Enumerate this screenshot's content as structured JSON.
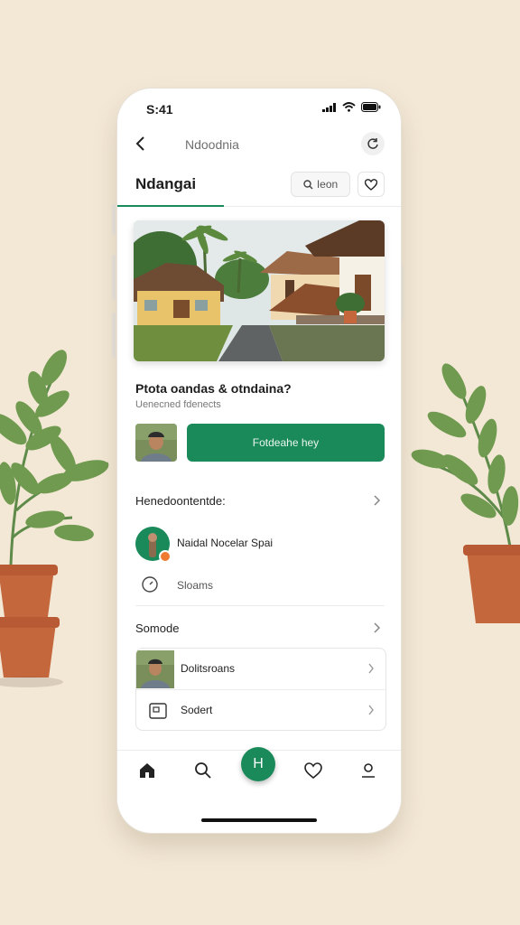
{
  "status_bar": {
    "time": "S:41"
  },
  "nav": {
    "title": "Ndoodnia"
  },
  "header": {
    "brand": "Ndangai",
    "search_label": "Ieon"
  },
  "content": {
    "title": "Ptota oandas & otndaina?",
    "subtitle": "Uenecned fdenects",
    "primary_button": "Fotdeahe hey"
  },
  "section_one": {
    "heading": "Henedoontentde:",
    "person_name": "Naidal Nocelar Spai",
    "status_label": "Sloams"
  },
  "section_two": {
    "heading": "Somode",
    "items": [
      {
        "label": "Dolitsroans"
      },
      {
        "label": "Sodert"
      }
    ]
  },
  "tabbar": {
    "fab_label": "H"
  },
  "colors": {
    "accent": "#1a8a5a",
    "background": "#f3e8d6",
    "status_dot": "#ee7b30"
  }
}
